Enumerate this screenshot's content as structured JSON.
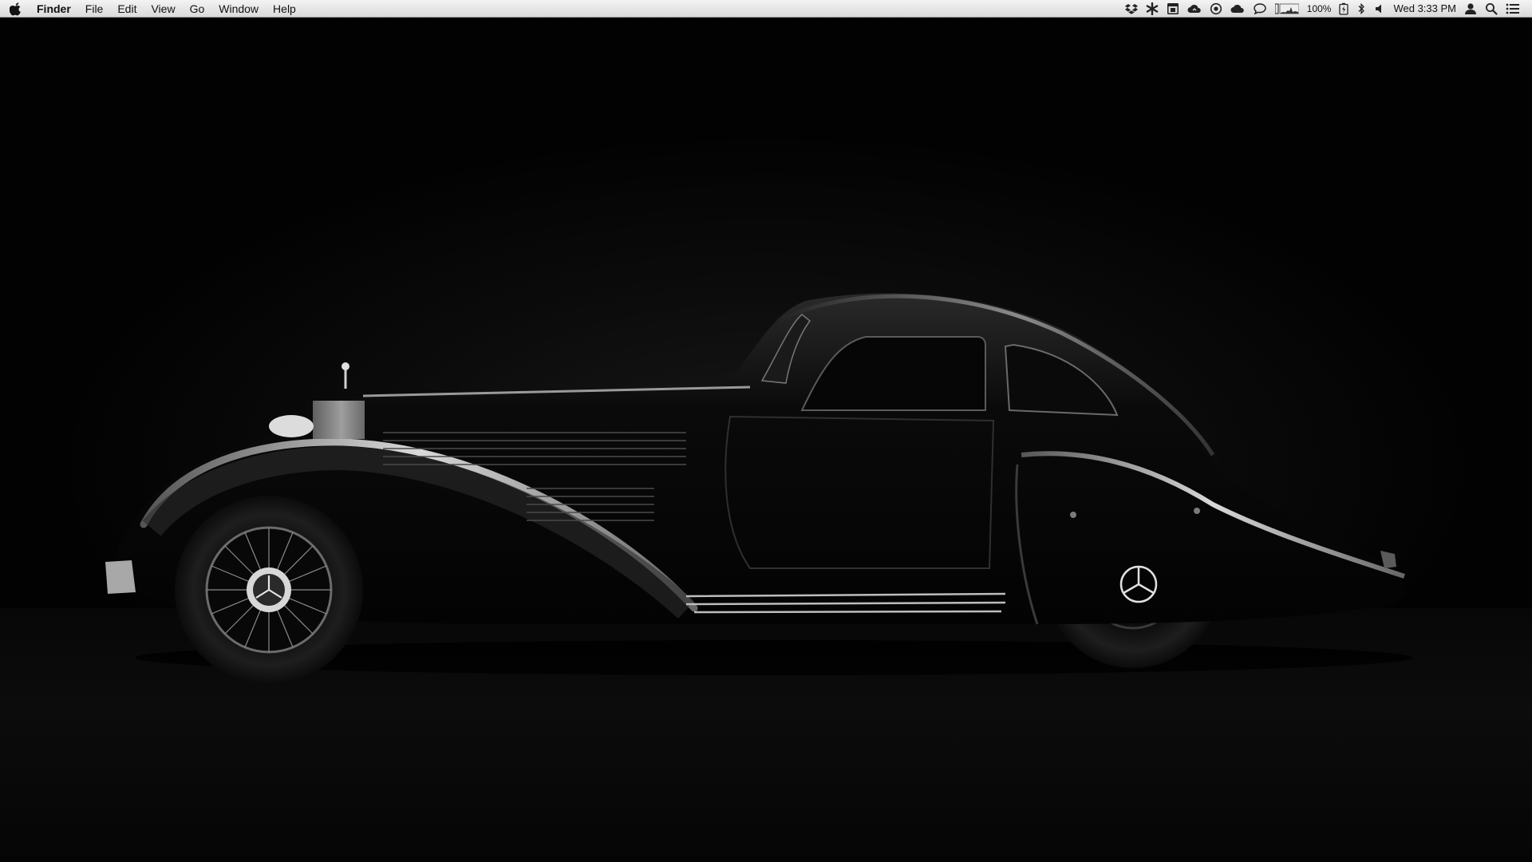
{
  "menubar": {
    "app_name": "Finder",
    "menus": [
      "File",
      "Edit",
      "View",
      "Go",
      "Window",
      "Help"
    ],
    "status": {
      "battery_percent": "100%",
      "clock": "Wed 3:33 PM"
    },
    "icons": [
      "apple-logo-icon",
      "dropbox-icon",
      "asterisk-icon",
      "calendar-icon",
      "cloud-sync-icon",
      "compass-icon",
      "cloud-icon",
      "chat-bubble-icon",
      "activity-graph-icon",
      "battery-icon",
      "bluetooth-icon",
      "volume-icon",
      "user-icon",
      "spotlight-search-icon",
      "notification-list-icon"
    ]
  },
  "desktop": {
    "wallpaper": "black-classic-coupe",
    "background_color": "#000000"
  }
}
